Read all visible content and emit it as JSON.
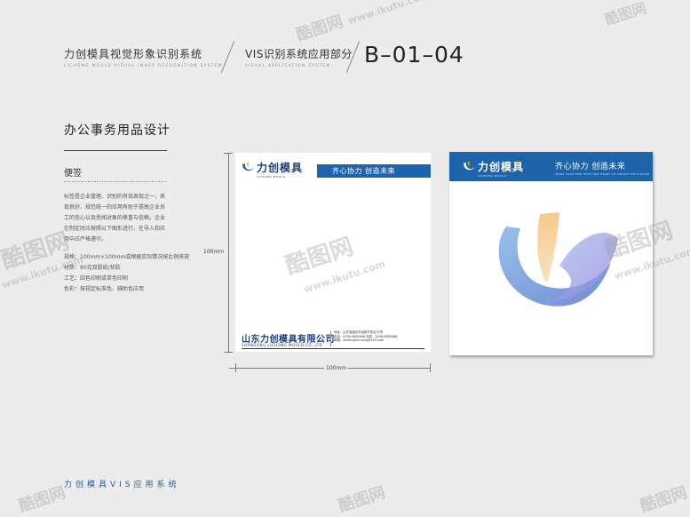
{
  "header": {
    "title_cn": "力创模具视觉形象识别系统",
    "title_en": "LICHONG MOULD VISUAL IMAGE RECOGNITION SYSTEM",
    "subtitle_cn": "VIS识别系统应用部分",
    "subtitle_en": "VISUAL APPLICATION SYSTEM",
    "code": "B–01–04"
  },
  "section": {
    "title": "办公事务用品设计",
    "item_title": "便签",
    "description": "标签是企业管理、识别的有效表现之一，表现良好、规范统一的应用有助于提高企业员工的信心以及受闻对象的尊重与信赖。企业在制定时应按照以下图形进行，在导入和应用中应严格遵守。",
    "specs": [
      "规格：100mm×100mm或根据实际情况按比例排放",
      "材质：80克双胶纸/背胶",
      "工艺：四色印刷或单色印刷",
      "色彩：按规定标准色、辅助色应用"
    ]
  },
  "dimensions": {
    "height_label": "100mm",
    "width_label": "100mm"
  },
  "brand": {
    "logo_cn": "力创模具",
    "logo_en": "LICHONG MOULD",
    "slogan": "齐心协力 创造未来",
    "slogan_en": "WORK TOGETHER WITH ONE HEART TO CREATE THE FUTURE",
    "primary_color": "#1e64ad",
    "dark_color": "#1c3f83"
  },
  "notepad": {
    "company_cn": "山东力创模具有限公司",
    "company_en": "SHANDONG LICHONG MOULD CO.,LTD",
    "contact": [
      "地址：山东省潍坊市高新开发区37号",
      "电话：0536-5885088  传真：0536-5885088",
      "邮箱：weifanglichuang@163.com"
    ]
  },
  "footer": "力创模具VIS应用系统",
  "watermark": {
    "cn": "酷图网",
    "url": "www.ikutu.com"
  }
}
